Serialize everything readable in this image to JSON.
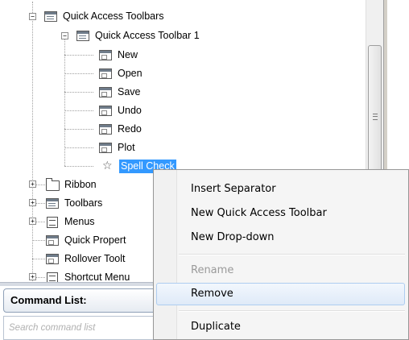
{
  "tree": {
    "items": [
      {
        "label": "Quick Access Toolbars",
        "icon": "quick-access-toolbars-icon",
        "expander": "−"
      },
      {
        "label": "Quick Access Toolbar 1",
        "icon": "toolbar-icon",
        "expander": "−"
      },
      {
        "label": "New",
        "icon": "command-icon"
      },
      {
        "label": "Open",
        "icon": "command-icon"
      },
      {
        "label": "Save",
        "icon": "command-icon"
      },
      {
        "label": "Undo",
        "icon": "command-icon"
      },
      {
        "label": "Redo",
        "icon": "command-icon"
      },
      {
        "label": "Plot",
        "icon": "command-icon"
      },
      {
        "label": "Spell Check",
        "icon": "star-icon",
        "selected": true
      },
      {
        "label": "Ribbon",
        "icon": "folder-icon",
        "expander": "+"
      },
      {
        "label": "Toolbars",
        "icon": "toolbars-icon",
        "expander": "+"
      },
      {
        "label": "Menus",
        "icon": "menus-icon",
        "expander": "+"
      },
      {
        "label": "Quick Propert",
        "icon": "quick-properties-icon"
      },
      {
        "label": "Rollover Toolt",
        "icon": "rollover-tooltips-icon"
      },
      {
        "label": "Shortcut Menu",
        "icon": "shortcut-menus-icon",
        "expander": "+"
      }
    ]
  },
  "command_list": {
    "header": "Command List:",
    "search_placeholder": "Search command list"
  },
  "context_menu": {
    "items": [
      {
        "label": "Insert Separator",
        "enabled": true
      },
      {
        "label": "New Quick Access Toolbar",
        "enabled": true
      },
      {
        "label": "New Drop-down",
        "enabled": true
      },
      {
        "label": "Rename",
        "enabled": false
      },
      {
        "label": "Remove",
        "enabled": true,
        "hovered": true
      },
      {
        "label": "Duplicate",
        "enabled": true
      }
    ]
  },
  "colors": {
    "selection": "#3399ff",
    "menu_hover_border": "#aecdf0"
  }
}
